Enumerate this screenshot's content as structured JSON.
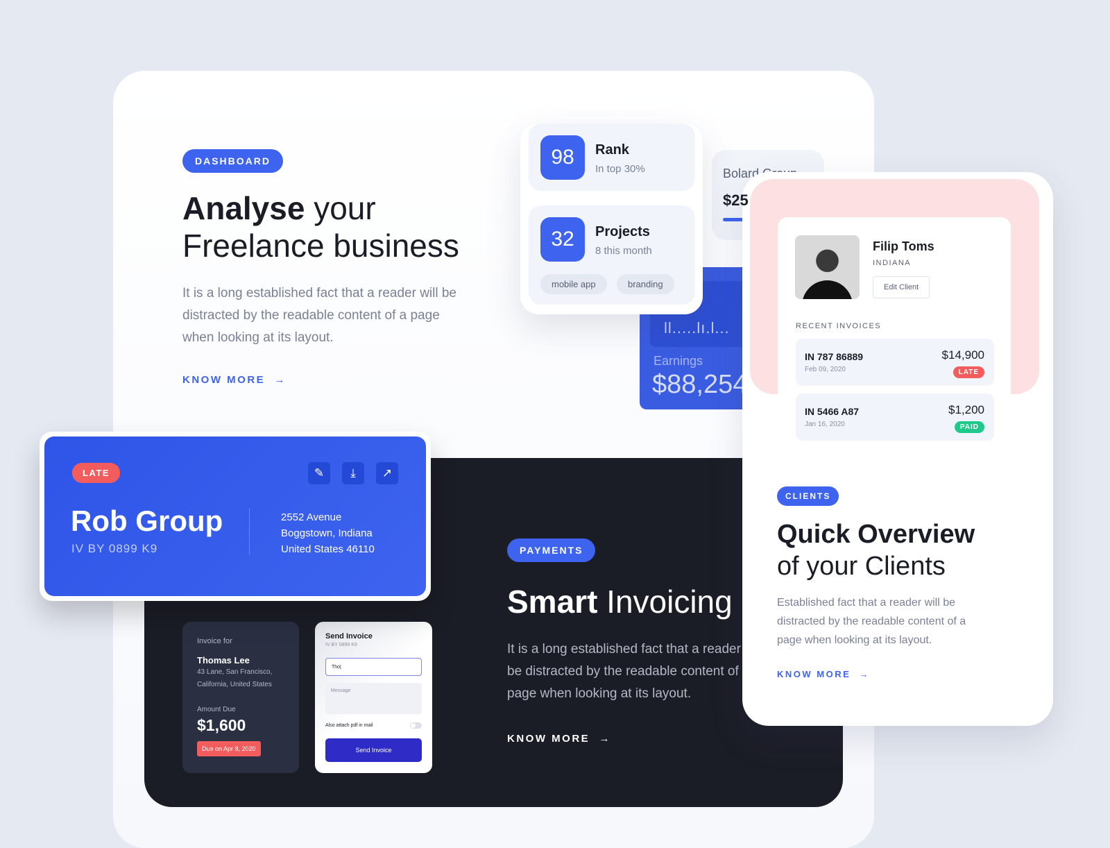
{
  "dashboard": {
    "pill": "DASHBOARD",
    "title_bold": "Analyse",
    "title_rest": " your",
    "title_line2": "Freelance business",
    "paragraph": "It is a long established fact that a reader will be distracted by the readable content of a page when looking at its layout.",
    "know_more": "KNOW MORE"
  },
  "stats": {
    "rank": {
      "value": "98",
      "title": "Rank",
      "subtitle": "In top 30%"
    },
    "projects": {
      "value": "32",
      "title": "Projects",
      "subtitle": "8 this month",
      "tags": [
        "mobile app",
        "branding"
      ]
    }
  },
  "bolard": {
    "name": "Bolard Group",
    "amount": "$25"
  },
  "earnings": {
    "label": "Earnings",
    "amount": "$88,254"
  },
  "invoice_card": {
    "status": "LATE",
    "name": "Rob Group",
    "id": "IV BY 0899 K9",
    "address": [
      "2552  Avenue",
      "Boggstown, Indiana",
      "United States 46110"
    ],
    "icons": [
      "edit-icon",
      "download-icon",
      "external-link-icon"
    ]
  },
  "payments": {
    "pill": "PAYMENTS",
    "title_bold": "Smart",
    "title_rest": " Invoicing",
    "paragraph": "It is a long established fact that a reader will be distracted by the readable content of a page when looking at its layout.",
    "know_more": "KNOW MORE"
  },
  "invoice_for": {
    "label": "Invoice for",
    "name": "Thomas Lee",
    "address1": "43 Lane, San Francisco,",
    "address2": "California, United States",
    "amount_label": "Amount Due",
    "amount": "$1,600",
    "due": "Due on Apr 8, 2020"
  },
  "send_invoice": {
    "title": "Send Invoice",
    "id": "IV BY 0899 K9",
    "to_value": "Tho|",
    "message_placeholder": "Message",
    "attach_label": "Also attach pdf in mail",
    "button": "Send Invoice"
  },
  "client": {
    "name": "Filip Toms",
    "location": "INDIANA",
    "edit": "Edit Client",
    "recent_label": "RECENT INVOICES",
    "invoices": [
      {
        "id": "IN 787 86889",
        "date": "Feb 09, 2020",
        "amount": "$14,900",
        "status": "LATE"
      },
      {
        "id": "IN 5466 A87",
        "date": "Jan 16, 2020",
        "amount": "$1,200",
        "status": "PAID"
      }
    ]
  },
  "clients": {
    "pill": "CLIENTS",
    "title_line1": "Quick Overview",
    "title_line2": "of your Clients",
    "paragraph": "Established fact that a reader will be distracted by the readable content of a page when looking at its layout.",
    "know_more": "KNOW MORE"
  },
  "colors": {
    "accent": "#3d63ef",
    "late": "#f25c5c",
    "paid": "#1ec98a",
    "dark": "#1b1d26"
  }
}
